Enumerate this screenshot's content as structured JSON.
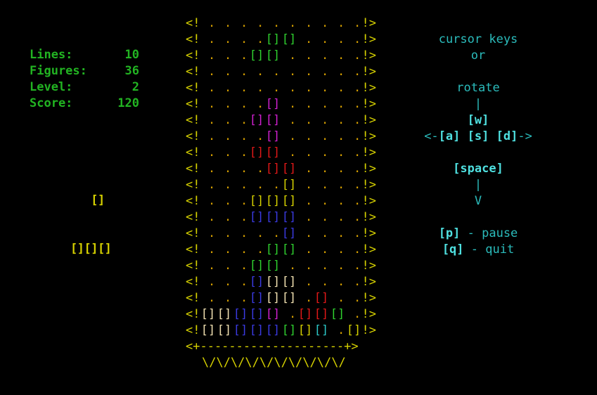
{
  "stats": {
    "lines_label": "Lines:",
    "lines_value": "10",
    "figures_label": "Figures:",
    "figures_value": "36",
    "level_label": "Level:",
    "level_value": "2",
    "score_label": "Score:",
    "score_value": "120"
  },
  "next_piece": {
    "row1": "   []",
    "row2": "[][][]",
    "color": "#d6d100"
  },
  "well": {
    "left_wall": "<!",
    "right_wall": "!>",
    "empty_cell": " .",
    "floor_left": "<+",
    "floor_mid": "--------------------",
    "floor_right": "+>",
    "base": "\\/\\/\\/\\/\\/\\/\\/\\/\\/\\/",
    "rows": [
      [
        0,
        0,
        0,
        0,
        0,
        0,
        0,
        0,
        0,
        0
      ],
      [
        0,
        0,
        0,
        0,
        "G",
        "G",
        0,
        0,
        0,
        0
      ],
      [
        0,
        0,
        0,
        "G",
        "G",
        0,
        0,
        0,
        0,
        0
      ],
      [
        0,
        0,
        0,
        0,
        0,
        0,
        0,
        0,
        0,
        0
      ],
      [
        0,
        0,
        0,
        0,
        0,
        0,
        0,
        0,
        0,
        0
      ],
      [
        0,
        0,
        0,
        0,
        "M",
        0,
        0,
        0,
        0,
        0
      ],
      [
        0,
        0,
        0,
        "M",
        "M",
        0,
        0,
        0,
        0,
        0
      ],
      [
        0,
        0,
        0,
        0,
        "M",
        0,
        0,
        0,
        0,
        0
      ],
      [
        0,
        0,
        0,
        "R",
        "R",
        0,
        0,
        0,
        0,
        0
      ],
      [
        0,
        0,
        0,
        0,
        "R",
        "R",
        0,
        0,
        0,
        0
      ],
      [
        0,
        0,
        0,
        0,
        0,
        "Y",
        0,
        0,
        0,
        0
      ],
      [
        0,
        0,
        0,
        "Y",
        "Y",
        "Y",
        0,
        0,
        0,
        0
      ],
      [
        0,
        0,
        0,
        "B",
        "B",
        "B",
        0,
        0,
        0,
        0
      ],
      [
        0,
        0,
        0,
        0,
        0,
        "B",
        0,
        0,
        0,
        0
      ],
      [
        0,
        0,
        0,
        0,
        "G",
        "G",
        0,
        0,
        0,
        0
      ],
      [
        0,
        0,
        0,
        "G",
        "G",
        0,
        0,
        0,
        0,
        0
      ],
      [
        0,
        0,
        0,
        "B",
        "W",
        "W",
        0,
        0,
        0,
        0
      ],
      [
        0,
        0,
        0,
        "B",
        "W",
        "W",
        0,
        "R",
        0,
        0
      ],
      [
        "W",
        "W",
        "B",
        "B",
        "M",
        0,
        "R",
        "R",
        "G",
        0
      ],
      [
        "W",
        "W",
        "B",
        "B",
        "B",
        "G",
        "Y",
        "C",
        0,
        "Y"
      ]
    ],
    "colors": {
      "G": "#2fd02f",
      "M": "#d020d0",
      "R": "#e01818",
      "Y": "#d6d100",
      "B": "#3a3ae0",
      "W": "#f0e0b0",
      "C": "#2cc8c8"
    }
  },
  "help": {
    "line1": "cursor keys",
    "line2": "or",
    "line3": "",
    "line4": "rotate",
    "line5": "|",
    "line6": "[w]",
    "line7a": "<-",
    "line7b": "[a]",
    "line7c": "[s]",
    "line7d": "[d]",
    "line7e": "->",
    "line8": "",
    "line9": "[space]",
    "line10": "|",
    "line11": "V",
    "line12": "",
    "line13a": "[p]",
    "line13b": " - pause",
    "line14a": "[q]",
    "line14b": " - quit"
  }
}
